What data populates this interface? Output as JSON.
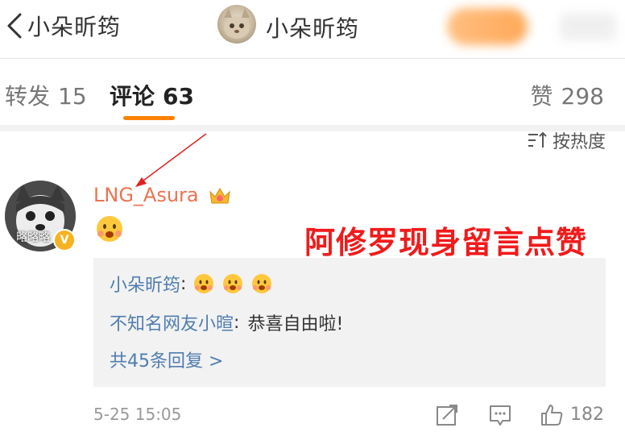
{
  "header": {
    "back_title": "小朵昕筠",
    "profile_name": "小朵昕筠"
  },
  "tabs": [
    {
      "label": "转发",
      "count": "15"
    },
    {
      "label": "评论",
      "count": "63"
    },
    {
      "label": "赞",
      "count": "298"
    }
  ],
  "sort": {
    "label": "按热度"
  },
  "comment": {
    "username": "LNG_Asura",
    "avatar_caption": "略略略",
    "timestamp": "5-25 15:05",
    "like_count": "182",
    "overlay_caption": "阿修罗现身留言点赞"
  },
  "replies": [
    {
      "user": "小朵昕筠",
      "separator": ":",
      "text": ""
    },
    {
      "user": "不知名网友小暄",
      "separator": ":",
      "text": "恭喜自由啦!"
    }
  ],
  "more_replies": "共45条回复 >",
  "colors": {
    "accent": "#ff8200",
    "username": "#eb7350",
    "link": "#507daf",
    "overlay_text": "#f01b1b"
  },
  "icons": [
    "back-icon",
    "sort-icon",
    "crown-icon",
    "emoji-icon",
    "share-icon",
    "reply-icon",
    "like-icon"
  ]
}
